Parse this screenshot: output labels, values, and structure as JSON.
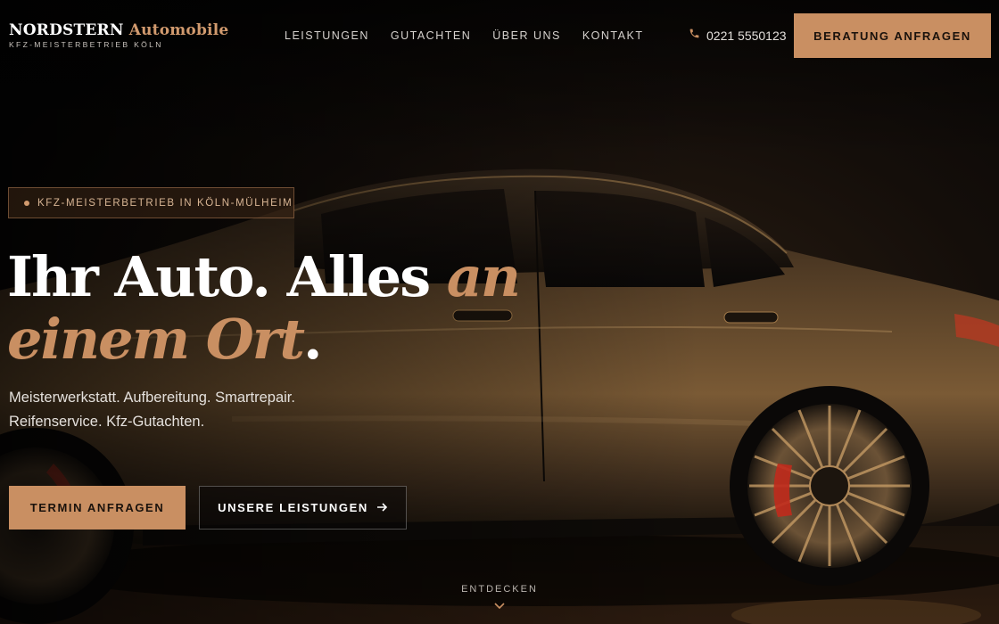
{
  "header": {
    "logo": {
      "main": "NORDSTERN",
      "accent": "Automobile",
      "sub": "KFZ-MEISTERBETRIEB KÖLN"
    },
    "nav": [
      "LEISTUNGEN",
      "GUTACHTEN",
      "ÜBER UNS",
      "KONTAKT"
    ],
    "phone": {
      "icon": "phone-icon",
      "number": "0221 5550123"
    },
    "cta_label": "BERATUNG ANFRAGEN"
  },
  "hero": {
    "badge": "KFZ-MEISTERBETRIEB IN KÖLN-MÜLHEIM",
    "headline": {
      "line1_white": "Ihr Auto. Alles ",
      "line1_accent": "an",
      "line2_accent": "einem Ort",
      "line2_white": "."
    },
    "subcopy": [
      "Meisterwerkstatt. Aufbereitung. Smartrepair.",
      "Reifenservice. Kfz-Gutachten."
    ],
    "primary_button": "TERMIN ANFRAGEN",
    "secondary_button": {
      "label": "UNSERE LEISTUNGEN",
      "icon": "arrow-right-icon"
    },
    "scroll": {
      "label": "ENTDECKEN",
      "icon": "chevron-down-icon"
    }
  },
  "colors": {
    "accent": "#c98f62",
    "background": "#0b0908",
    "text": "#ffffff"
  }
}
